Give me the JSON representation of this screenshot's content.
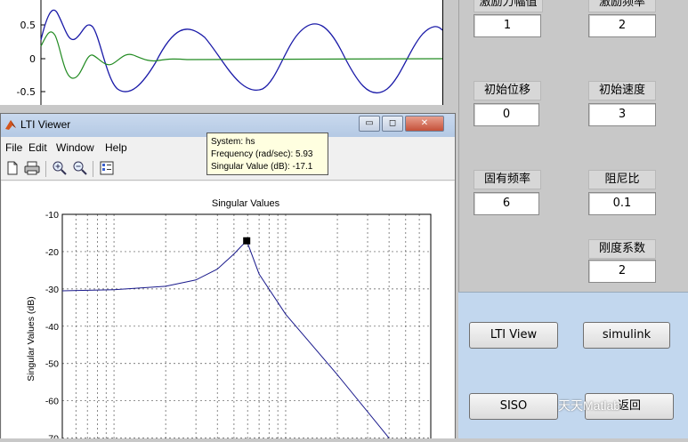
{
  "background_figure": {
    "top_axes": {
      "y_ticks": [
        "0.5",
        "0",
        "-0.5"
      ],
      "series_colors": {
        "blue": "#1a1aa8",
        "green": "#228b22"
      }
    }
  },
  "right_panel": {
    "fields": [
      {
        "label": "激励力幅值",
        "value": "1"
      },
      {
        "label": "激励频率",
        "value": "2"
      },
      {
        "label": "初始位移",
        "value": "0"
      },
      {
        "label": "初始速度",
        "value": "3"
      },
      {
        "label": "固有频率",
        "value": "6"
      },
      {
        "label": "阻尼比",
        "value": "0.1"
      },
      {
        "label": "刚度系数",
        "value": "2"
      }
    ]
  },
  "button_panel": {
    "lti_view": "LTI View",
    "simulink": "simulink",
    "siso": "SISO",
    "back": "返回"
  },
  "lti_window": {
    "title": "LTI Viewer",
    "window_buttons": {
      "minimize": "▭",
      "maximize": "◻",
      "close": "✕"
    },
    "menu": [
      "File",
      "Edit",
      "Window",
      "Help"
    ],
    "toolbar_icons": [
      "new-file-icon",
      "print-icon",
      "zoom-in-icon",
      "zoom-out-icon",
      "plot-config-icon"
    ],
    "plot": {
      "title": "Singular Values",
      "ylabel": "Singular Values (dB)",
      "y_ticks": [
        "-10",
        "-20",
        "-30",
        "-40",
        "-50",
        "-60",
        "-70"
      ]
    },
    "datatip": {
      "system": "System: hs",
      "frequency": "Frequency (rad/sec): 5.93",
      "singular_value": "Singular Value (dB): -17.1"
    }
  },
  "watermark": "天天Matlab",
  "chart_data": {
    "type": "line",
    "title": "Singular Values",
    "xlabel": "",
    "ylabel": "Singular Values (dB)",
    "ylim": [
      -70,
      -10
    ],
    "grid": true,
    "x_scale": "log",
    "series": [
      {
        "x": [
          0.1,
          1,
          2,
          3,
          4,
          5,
          5.5,
          5.93,
          7,
          10,
          20,
          40
        ],
        "values": [
          -30.5,
          -30.2,
          -29.3,
          -27.6,
          -24.7,
          -20.6,
          -18.6,
          -17.1,
          -26,
          -36.8,
          -53,
          -70
        ]
      }
    ],
    "datatip": {
      "system": "hs",
      "frequency": 5.93,
      "singular_value": -17.1
    }
  }
}
